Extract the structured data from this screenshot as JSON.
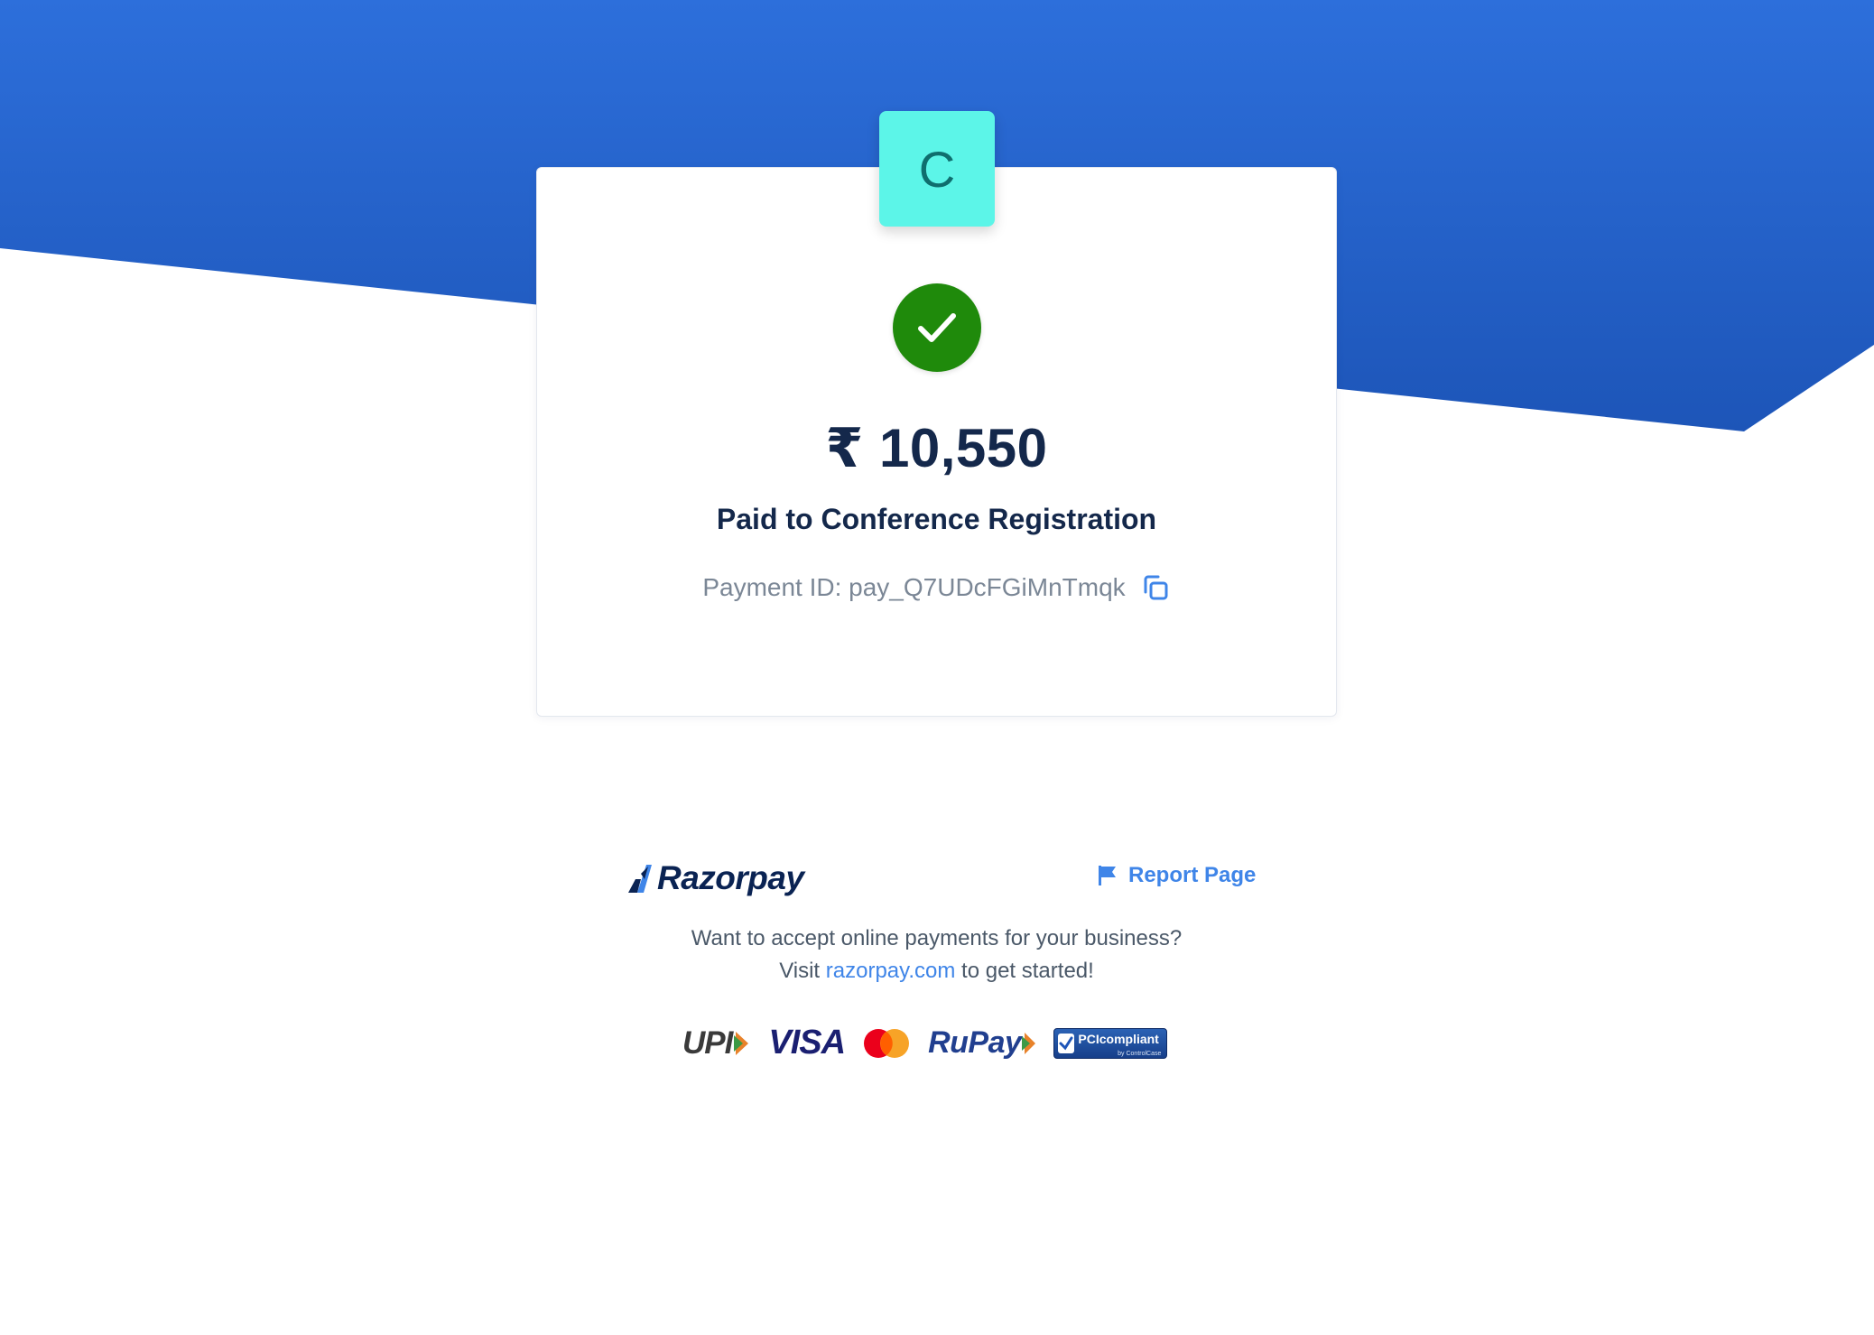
{
  "merchant": {
    "logo_letter": "C",
    "logo_color": "#5cf5e8"
  },
  "status": {
    "icon": "check-circle-icon",
    "color": "#1f8a0b"
  },
  "payment": {
    "amount": "₹ 10,550",
    "paid_to": "Paid to Conference Registration",
    "payment_id_text": "Payment ID: pay_Q7UDcFGiMnTmqk"
  },
  "footer": {
    "brand": "Razorpay",
    "report_label": "Report Page",
    "cta_line1": "Want to accept online payments for your business?",
    "cta_visit": "Visit",
    "cta_link": "razorpay.com",
    "cta_suffix": "to get started!"
  },
  "payment_methods": {
    "upi": "UPI",
    "visa": "VISA",
    "rupay": "RuPay",
    "pci": "PCIcompliant",
    "pci_sub": "by ControlCase"
  },
  "colors": {
    "header_band": "#2a6bd6",
    "accent_link": "#3f85e8",
    "heading_text": "#14284b"
  }
}
